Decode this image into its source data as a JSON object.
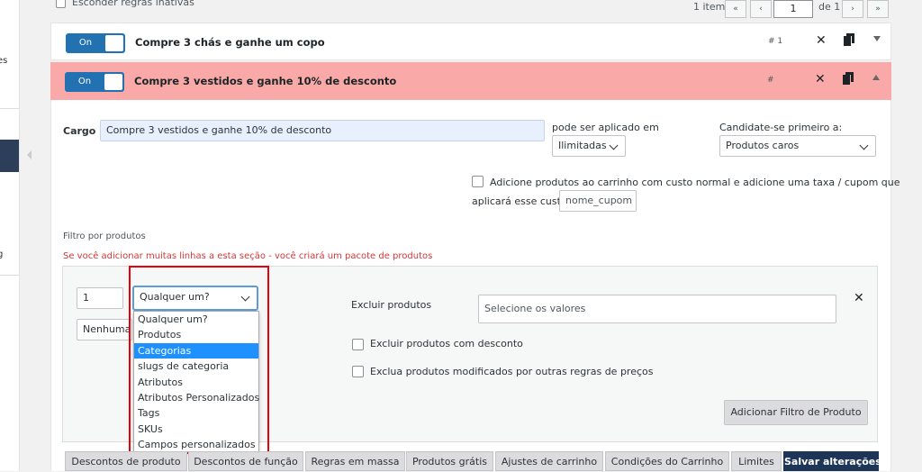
{
  "sidebar_fragments": [
    "es",
    "g"
  ],
  "top": {
    "hide_inactive_label": "Esconder regras inativas",
    "item_count": "1 item",
    "first": "«",
    "prev": "‹",
    "page": "1",
    "of_pages": "de 1",
    "next": "›",
    "last": "»"
  },
  "rules": [
    {
      "toggle": "On",
      "title": "Compre 3 chás e ganhe um copo",
      "num": "# 1"
    },
    {
      "toggle": "On",
      "title": "Compre 3 vestidos e ganhe 10% de desconto",
      "num": "#"
    }
  ],
  "form": {
    "cargo_label": "Cargo",
    "cargo_value": "Compre 3 vestidos e ganhe 10% de desconto",
    "apply_label": "pode ser aplicado em",
    "apply_value": "Ilimitadas",
    "candidate_label": "Candidate-se primeiro a:",
    "candidate_value": "Produtos caros",
    "add_products_line1": "Adicione produtos ao carrinho com custo normal e adicione uma taxa / cupom que",
    "add_products_line2": "aplicará esse custo",
    "coupon_placeholder": "nome_cupom"
  },
  "filter": {
    "title": "Filtro por produtos",
    "warning": "Se você adicionar muitas linhas a esta seção - você criará um pacote de produtos",
    "qty": "1",
    "type_selected": "Qualquer um?",
    "second_select": "Nenhuma",
    "exclude_label": "Excluir produtos",
    "exclude_placeholder": "Selecione os valores",
    "exclude_discounted": "Excluir produtos com desconto",
    "exclude_modified": "Exclua produtos modificados por outras regras de preços",
    "add_filter_btn": "Adicionar Filtro de Produto",
    "options": [
      "Qualquer um?",
      "Produtos",
      "Categorias",
      "slugs de categoria",
      "Atributos",
      "Atributos Personalizados",
      "Tags",
      "SKUs",
      "Campos personalizados"
    ],
    "highlighted_index": 2
  },
  "tabs": [
    "Descontos de produto",
    "Descontos de função",
    "Regras em massa",
    "Produtos grátis",
    "Ajustes de carrinho",
    "Condições do Carrinho",
    "Limites",
    "Salvar alterações"
  ],
  "colors": {
    "accent": "#2271b1",
    "active_rule": "#f9aaa8",
    "save": "#1d3557",
    "highlight": "#1e90ff",
    "annotation": "#e8000b",
    "warning": "#d63638"
  }
}
